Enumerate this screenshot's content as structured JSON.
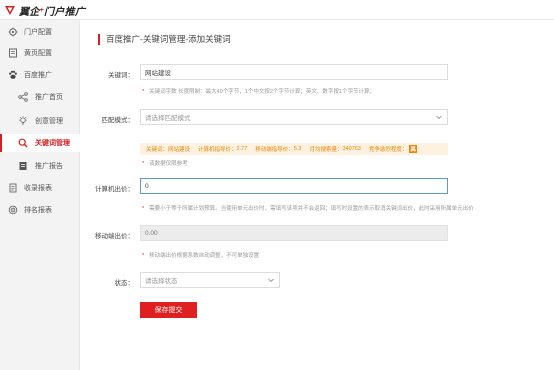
{
  "header": {
    "brand_prefix": "翼企",
    "brand_plus": "+",
    "brand_suffix": "门户推广"
  },
  "sidebar": {
    "items": [
      {
        "label": "门户配置",
        "icon": "gear-icon"
      },
      {
        "label": "黄页配置",
        "icon": "yellow-pages-icon"
      },
      {
        "label": "百度推广",
        "icon": "paw-icon"
      },
      {
        "label": "推广首页",
        "icon": "share-icon"
      },
      {
        "label": "创意管理",
        "icon": "bulb-icon"
      },
      {
        "label": "关键词管理",
        "icon": "search-icon"
      },
      {
        "label": "推广报告",
        "icon": "report-icon"
      },
      {
        "label": "收录报表",
        "icon": "document-icon"
      },
      {
        "label": "排名报表",
        "icon": "target-icon"
      }
    ],
    "active_index": 5
  },
  "page": {
    "title": "百度推广-关键词管理-添加关键词"
  },
  "form": {
    "keyword": {
      "label": "关键词：",
      "value": "网站建设",
      "hint": "关键词字数 长度限制：最大40个字节，1个中文按2个字节计算；英文、数字按1个字节计算；"
    },
    "match_mode": {
      "label": "匹配模式：",
      "placeholder": "请选择匹配模式",
      "hint": "该数据仅限参考"
    },
    "keyword_info": {
      "keyword_label": "关键词：",
      "keyword_value": "网站建设",
      "pc_price_label": "计算机指导价：",
      "pc_price_value": "2.77",
      "mobile_price_label": "移动端指导价：",
      "mobile_price_value": "5.3",
      "monthly_search_label": "月均搜索量：",
      "monthly_search_value": "340763",
      "competition_label": "竞争激烈程度：",
      "competition_value": "高"
    },
    "pc_bid": {
      "label": "计算机出价：",
      "value": "0",
      "hint": "需要小于等于所属计划预算。当使用单元出价时，需填写该项并不会返回；填写时设置的表示取消关键词出价，此时采用所属单元出价"
    },
    "mobile_bid": {
      "label": "移动端出价：",
      "value": "0.00",
      "hint": "移动端出价根据系数自动调整，不可单独设置"
    },
    "status": {
      "label": "状态：",
      "placeholder": "请选择状态"
    },
    "submit_label": "保存提交"
  },
  "colors": {
    "accent": "#d71f1f",
    "info_bg": "#fdf1e0",
    "info_text": "#e8860c",
    "focus_border": "#5b9bd5"
  }
}
